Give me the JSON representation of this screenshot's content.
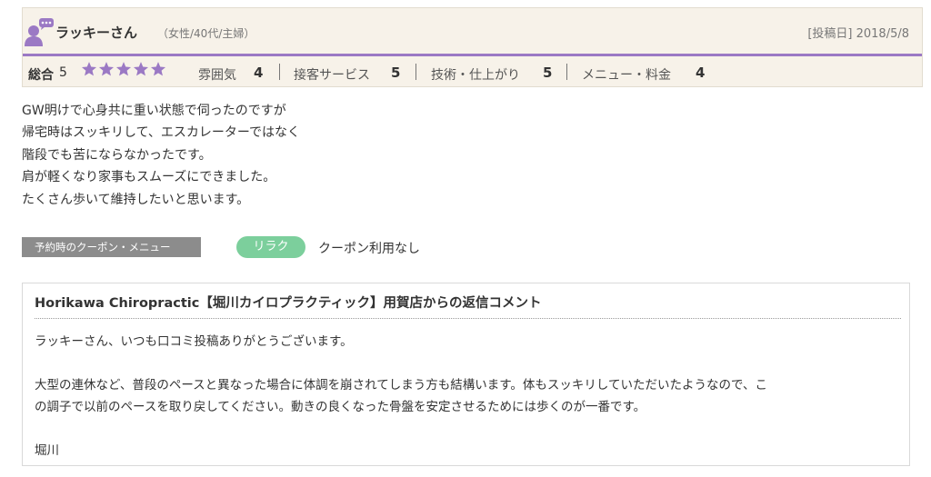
{
  "reviewer": {
    "name": "ラッキーさん",
    "meta": "（女性/40代/主婦）",
    "post_date": "[投稿日] 2018/5/8"
  },
  "rating": {
    "total_label": "総合",
    "total_value": "5",
    "stars": 5,
    "star_color": "#9b79c4",
    "categories": [
      {
        "label": "雰囲気",
        "value": "4"
      },
      {
        "label": "接客サービス",
        "value": "5"
      },
      {
        "label": "技術・仕上がり",
        "value": "5"
      },
      {
        "label": "メニュー・料金",
        "value": "4"
      }
    ]
  },
  "review_lines": [
    "GW明けで心身共に重い状態で伺ったのですが",
    "帰宅時はスッキリして、エスカレーターではなく",
    "階段でも苦にならなかったです。",
    "肩が軽くなり家事もスムーズにできました。",
    "たくさん歩いて維持したいと思います。"
  ],
  "coupon": {
    "label": "予約時のクーポン・メニュー",
    "tag": "リラク",
    "text": "クーポン利用なし",
    "tag_color": "#7ccf9c"
  },
  "reply": {
    "title": "Horikawa Chiropractic【堀川カイロプラクティック】用賀店からの返信コメント",
    "line1": "ラッキーさん、いつも口コミ投稿ありがとうございます。",
    "line2a": "大型の連休など、普段のペースと異なった場合に体調を崩されてしまう方も結構います。体もスッキリしていただいたようなので、こ",
    "line2b": "の調子で以前のペースを取り戻してください。動きの良くなった骨盤を安定させるためには歩くのが一番です。",
    "signature": "堀川"
  },
  "icons": {
    "avatar": "person-with-speech-bubble-icon",
    "star": "star-icon"
  },
  "colors": {
    "header_bg": "#f7f2e9",
    "accent_purple": "#9b79c4",
    "coupon_label_bg": "#8c8c8c"
  }
}
